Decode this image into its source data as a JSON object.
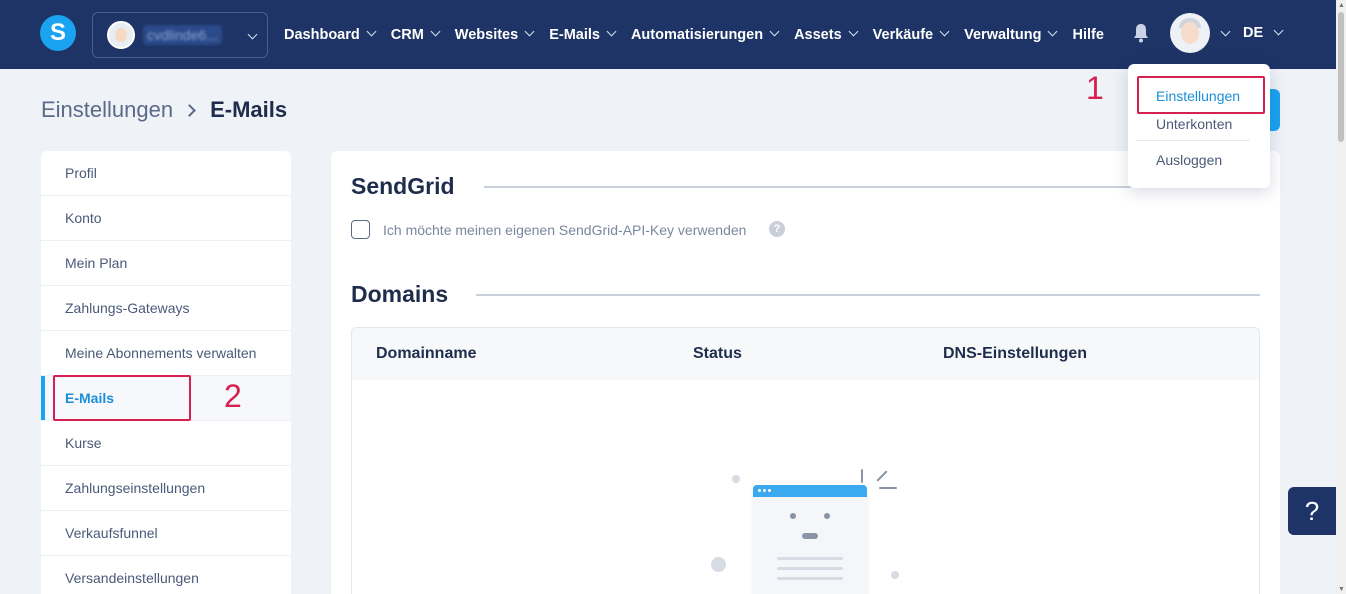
{
  "nav": {
    "logo_letter": "S",
    "account_name": "cvdlinde6...",
    "items": [
      "Dashboard",
      "CRM",
      "Websites",
      "E-Mails",
      "Automatisierungen",
      "Assets",
      "Verkäufe",
      "Verwaltung"
    ],
    "help_label": "Hilfe",
    "language": "DE"
  },
  "breadcrumb": {
    "parent": "Einstellungen",
    "current": "E-Mails"
  },
  "sidebar": {
    "items": [
      {
        "label": "Profil",
        "active": false
      },
      {
        "label": "Konto",
        "active": false
      },
      {
        "label": "Mein Plan",
        "active": false
      },
      {
        "label": "Zahlungs-Gateways",
        "active": false
      },
      {
        "label": "Meine Abonnements verwalten",
        "active": false
      },
      {
        "label": "E-Mails",
        "active": true
      },
      {
        "label": "Kurse",
        "active": false
      },
      {
        "label": "Zahlungseinstellungen",
        "active": false
      },
      {
        "label": "Verkaufsfunnel",
        "active": false
      },
      {
        "label": "Versandeinstellungen",
        "active": false
      }
    ]
  },
  "main": {
    "sendgrid_title": "SendGrid",
    "sendgrid_checkbox_label": "Ich möchte meinen eigenen SendGrid-API-Key verwenden",
    "sendgrid_checkbox_checked": false,
    "domains_title": "Domains",
    "domains_columns": [
      "Domainname",
      "Status",
      "DNS-Einstellungen"
    ]
  },
  "user_menu": {
    "items": [
      "Einstellungen",
      "Unterkonten",
      "Ausloggen"
    ]
  },
  "annotations": {
    "first": "1",
    "second": "2"
  },
  "help_button": "?",
  "colors": {
    "nav_bg": "#1e3466",
    "accent": "#1aa3f0",
    "annotation": "#d6204f"
  }
}
